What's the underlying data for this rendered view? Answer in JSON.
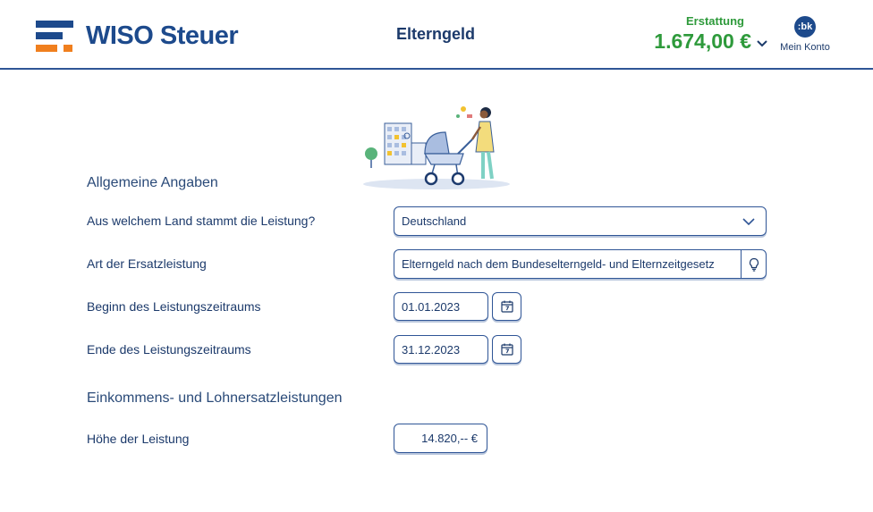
{
  "header": {
    "brand": "WISO Steuer",
    "page_title": "Elterngeld",
    "refund_label": "Erstattung",
    "refund_amount": "1.674,00 €",
    "avatar_initials": ":bk",
    "account_label": "Mein Konto"
  },
  "colors": {
    "brand_blue": "#1d4a8c",
    "brand_orange": "#f07f1e",
    "refund_green": "#2e9a3b",
    "field_border": "#2f5596"
  },
  "icons": {
    "chevron": "chevron-down-icon",
    "hint": "lightbulb-icon",
    "calendar": "calendar-icon"
  },
  "sections": {
    "general_heading": "Allgemeine Angaben",
    "income_heading": "Einkommens- und Lohnersatzleistungen"
  },
  "form": {
    "country_label": "Aus welchem Land stammt die Leistung?",
    "country_value": "Deutschland",
    "type_label": "Art der Ersatzleistung",
    "type_value": "Elterngeld nach dem Bundeselterngeld- und Elternzeitgesetz",
    "start_label": "Beginn des Leistungszeitraums",
    "start_value": "01.01.2023",
    "end_label": "Ende des Leistungszeitraums",
    "end_value": "31.12.2023",
    "amount_label": "Höhe der Leistung",
    "amount_value": "14.820,-- €"
  }
}
